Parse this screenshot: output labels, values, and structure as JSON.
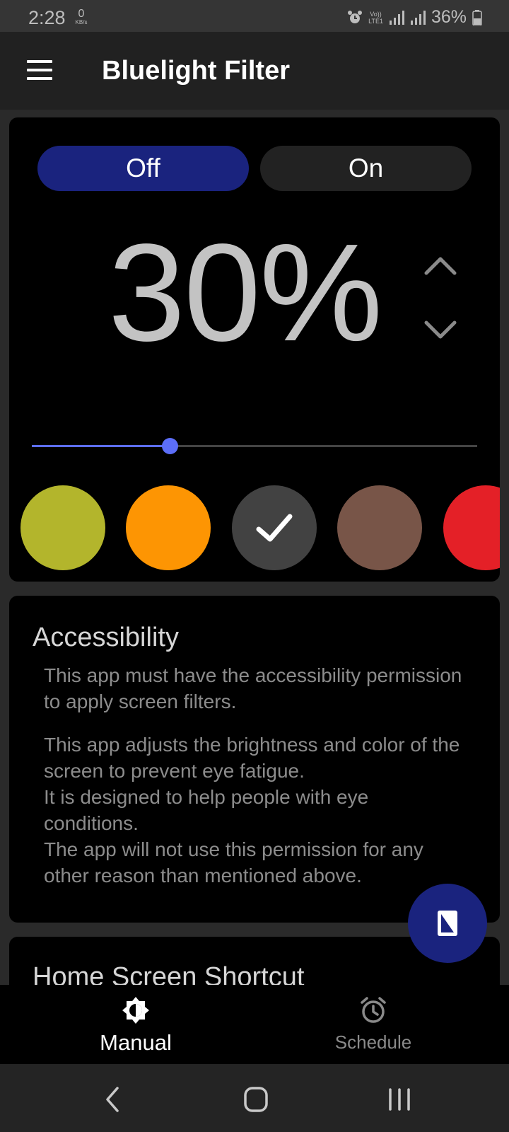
{
  "status_bar": {
    "time": "2:28",
    "net_speed_value": "0",
    "net_speed_unit": "KB/s",
    "network_label_top": "Vo))",
    "network_label_bottom": "LTE1",
    "battery": "36%"
  },
  "app_bar": {
    "title": "Bluelight Filter",
    "menu_icon": "hamburger-menu-icon"
  },
  "filter_card": {
    "off_label": "Off",
    "on_label": "On",
    "selected_toggle": "off",
    "intensity_text": "30%",
    "intensity_value": 30,
    "slider_position_fraction": 0.31,
    "accent_color": "#5c6ef8",
    "swatches": [
      {
        "name": "olive",
        "color": "#b3b52c",
        "selected": false
      },
      {
        "name": "orange",
        "color": "#fd9503",
        "selected": false
      },
      {
        "name": "dark-gray",
        "color": "#424242",
        "selected": true
      },
      {
        "name": "brown",
        "color": "#785548",
        "selected": false
      },
      {
        "name": "red",
        "color": "#e42027",
        "selected": false
      }
    ]
  },
  "accessibility_card": {
    "heading": "Accessibility",
    "paragraph1": "This app must have the accessibility permission to apply screen filters.",
    "paragraph2_lines": [
      "This app adjusts the brightness and color of the screen to prevent eye fatigue.",
      "It is designed to help people with eye conditions.",
      "The app will not use this permission for any other reason than mentioned above."
    ]
  },
  "shortcut_card": {
    "heading": "Home Screen Shortcut"
  },
  "fab": {
    "icon": "phone-filter-icon",
    "color": "#1a237e"
  },
  "bottom_nav": {
    "items": [
      {
        "label": "Manual",
        "icon": "brightness-icon",
        "active": true
      },
      {
        "label": "Schedule",
        "icon": "alarm-clock-icon",
        "active": false
      }
    ]
  },
  "system_nav": [
    "back",
    "home",
    "recents"
  ]
}
